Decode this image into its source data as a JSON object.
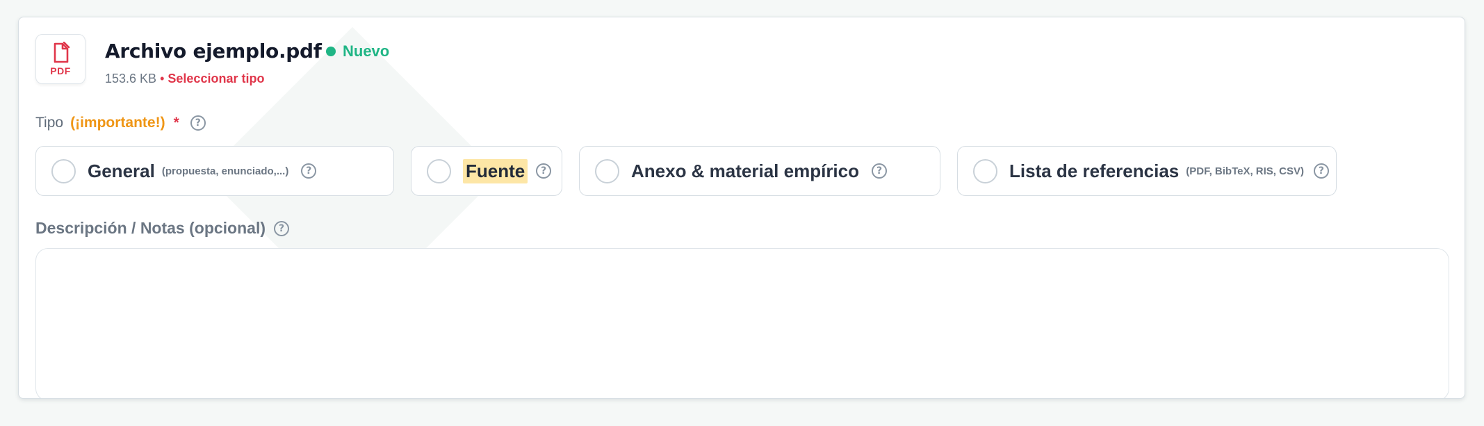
{
  "file": {
    "icon_label": "PDF",
    "name": "Archivo ejemplo.pdf",
    "status": "Nuevo",
    "size": "153.6 KB",
    "separator": "•",
    "select_type_label": "Seleccionar tipo"
  },
  "tipo": {
    "label": "Tipo",
    "important": "(¡importante!)",
    "required_mark": "*",
    "help": "?"
  },
  "options": [
    {
      "label": "General",
      "hint": "(propuesta, enunciado,...)",
      "help": "?"
    },
    {
      "label": "Fuente",
      "hint": "",
      "help": "?"
    },
    {
      "label": "Anexo & material empírico",
      "hint": "",
      "help": "?"
    },
    {
      "label": "Lista de referencias",
      "hint": "(PDF, BibTeX, RIS, CSV)",
      "help": "?"
    }
  ],
  "description": {
    "label": "Descripción / Notas (opcional)",
    "help": "?",
    "value": ""
  },
  "colors": {
    "accent_red": "#e0364a",
    "status_green": "#1fb585",
    "important_orange": "#ef9616",
    "highlight_yellow": "#fde6a6"
  }
}
